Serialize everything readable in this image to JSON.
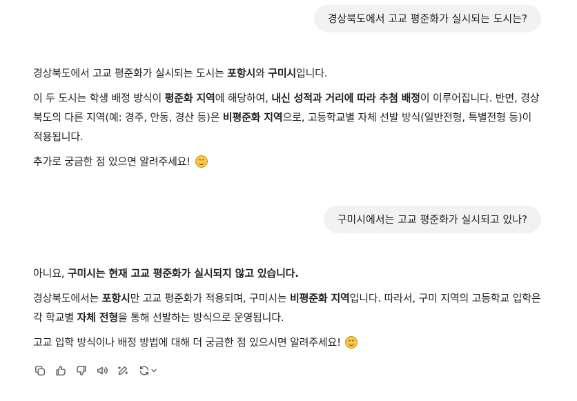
{
  "conversation": {
    "q1": "경상북도에서 고교 평준화가 실시되는 도시는?",
    "a1": {
      "p1": {
        "t1": "경상북도에서 고교 평준화가 실시되는 도시는 ",
        "b1": "포항시",
        "t2": "와 ",
        "b2": "구미시",
        "t3": "입니다."
      },
      "p2": {
        "t1": "이 두 도시는 학생 배정 방식이 ",
        "b1": "평준화 지역",
        "t2": "에 해당하여, ",
        "b2": "내신 성적과 거리에 따라 추첨 배정",
        "t3": "이 이루어집니다. 반면, 경상북도의 다른 지역(예: 경주, 안동, 경산 등)은 ",
        "b3": "비평준화 지역",
        "t4": "으로, 고등학교별 자체 선발 방식(일반전형, 특별전형 등)이 적용됩니다."
      },
      "p3": {
        "t1": "추가로 궁금한 점 있으면 알려주세요! "
      }
    },
    "q2": "구미시에서는 고교 평준화가 실시되고 있나?",
    "a2": {
      "p1": {
        "t1": "아니요, ",
        "b1": "구미시는 현재 고교 평준화가 실시되지 않고 있습니다."
      },
      "p2": {
        "t1": "경상북도에서는 ",
        "b1": "포항시",
        "t2": "만 고교 평준화가 적용되며, 구미시는 ",
        "b2": "비평준화 지역",
        "t3": "입니다. 따라서, 구미 지역의 고등학교 입학은 각 학교별 ",
        "b3": "자체 전형",
        "t4": "을 통해 선발하는 방식으로 운영됩니다."
      },
      "p3": {
        "t1": "고교 입학 방식이나 배정 방법에 대해 더 궁금한 점 있으시면 알려주세요! "
      }
    }
  },
  "toolbar": {
    "icons": [
      "copy-icon",
      "thumbs-up-icon",
      "thumbs-down-icon",
      "read-aloud-icon",
      "edit-icon",
      "regenerate-icon",
      "chevron-down-icon"
    ]
  },
  "colors": {
    "user_bubble": "#f2f2f2",
    "text": "#1f1f1f",
    "icon": "#5d5d5d"
  }
}
